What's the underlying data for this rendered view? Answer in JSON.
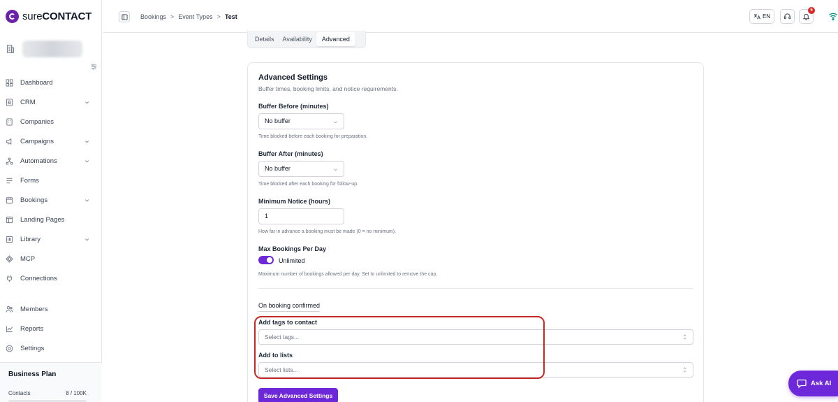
{
  "brand": {
    "name_light": "sure",
    "name_bold": "CONTACT",
    "accent": "#6d28d9"
  },
  "sidebar": {
    "items": [
      {
        "label": "Dashboard",
        "icon": "dashboard-icon",
        "has_children": false
      },
      {
        "label": "CRM",
        "icon": "crm-icon",
        "has_children": true
      },
      {
        "label": "Companies",
        "icon": "companies-icon",
        "has_children": false
      },
      {
        "label": "Campaigns",
        "icon": "campaigns-icon",
        "has_children": true
      },
      {
        "label": "Automations",
        "icon": "automations-icon",
        "has_children": true
      },
      {
        "label": "Forms",
        "icon": "forms-icon",
        "has_children": false
      },
      {
        "label": "Bookings",
        "icon": "bookings-icon",
        "has_children": true
      },
      {
        "label": "Landing Pages",
        "icon": "landing-pages-icon",
        "has_children": false
      },
      {
        "label": "Library",
        "icon": "library-icon",
        "has_children": true
      },
      {
        "label": "MCP",
        "icon": "mcp-icon",
        "has_children": false
      },
      {
        "label": "Connections",
        "icon": "connections-icon",
        "has_children": false
      },
      {
        "label": "Members",
        "icon": "members-icon",
        "has_children": false
      },
      {
        "label": "Reports",
        "icon": "reports-icon",
        "has_children": false
      },
      {
        "label": "Settings",
        "icon": "settings-icon",
        "has_children": false
      }
    ],
    "plan": {
      "title": "Business Plan",
      "contacts_label": "Contacts",
      "contacts_value": "8 / 100K"
    }
  },
  "header": {
    "breadcrumb": [
      "Bookings",
      "Event Types",
      "Test"
    ],
    "language": "EN",
    "notification_count": "5"
  },
  "tabs": [
    {
      "label": "Details",
      "active": false
    },
    {
      "label": "Availability",
      "active": false
    },
    {
      "label": "Advanced",
      "active": true
    }
  ],
  "advanced": {
    "title": "Advanced Settings",
    "subtitle": "Buffer times, booking limits, and notice requirements.",
    "buffer_before": {
      "label": "Buffer Before (minutes)",
      "value": "No buffer",
      "help": "Time blocked before each booking for preparation."
    },
    "buffer_after": {
      "label": "Buffer After (minutes)",
      "value": "No buffer",
      "help": "Time blocked after each booking for follow-up."
    },
    "min_notice": {
      "label": "Minimum Notice (hours)",
      "value": "1",
      "help": "How far in advance a booking must be made (0 = no minimum)."
    },
    "max_per_day": {
      "label": "Max Bookings Per Day",
      "toggle_label": "Unlimited",
      "help": "Maximum number of bookings allowed per day. Set to unlimited to remove the cap."
    },
    "on_confirmed": "On booking confirmed",
    "tags": {
      "label": "Add tags to contact",
      "placeholder": "Select tags..."
    },
    "lists": {
      "label": "Add to lists",
      "placeholder": "Select lists..."
    },
    "save_label": "Save Advanced Settings"
  },
  "ask_ai": {
    "label": "Ask AI"
  }
}
